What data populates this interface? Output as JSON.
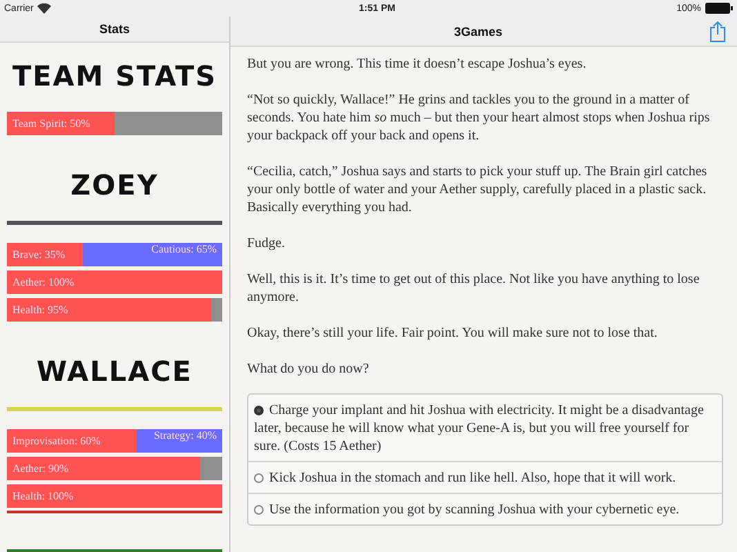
{
  "status_bar": {
    "carrier": "Carrier",
    "time": "1:51 PM",
    "battery": "100%"
  },
  "sidebar": {
    "title": "Stats",
    "team": {
      "heading": "TEAM STATS",
      "bars": [
        {
          "kind": "single",
          "label": "Team Spirit: 50%",
          "level": 0.5
        }
      ]
    },
    "characters": [
      {
        "name": "ZOEY",
        "color": "#555555",
        "bars": [
          {
            "kind": "split",
            "label": "Brave: 35%",
            "right_label": "Cautious: 65%",
            "level": 0.35
          },
          {
            "kind": "single",
            "label": "Aether: 100%",
            "level": 1
          },
          {
            "kind": "single",
            "label": "Health: 95%",
            "level": 0.95
          }
        ]
      },
      {
        "name": "WALLACE",
        "color": "#d4d45a",
        "bars": [
          {
            "kind": "split",
            "label": "Improvisation: 60%",
            "right_label": "Strategy: 40%",
            "level": 0.6
          },
          {
            "kind": "single",
            "label": "Aether: 90%",
            "level": 0.9
          },
          {
            "kind": "single",
            "label": "Health: 100%",
            "level": 1
          }
        ]
      }
    ],
    "extra_rules": [
      {
        "color": "#c0392b"
      },
      {
        "color": "#2e7d32"
      }
    ]
  },
  "story": {
    "title": "3Games",
    "paragraphs": [
      "But you are wrong. This time it doesn’t escape Joshua’s eyes.",
      "“Not so quickly, Wallace!” He grins and tackles you to the ground in a matter of seconds. You hate him *so* much – but then your heart almost stops when Joshua rips your backpack off your back and opens it.",
      "“Cecilia, catch,” Joshua says and starts to pick your stuff up. The Brain girl catches your only bottle of water and your Aether supply, carefully placed in a plastic sack. Basically everything you had.",
      "Fudge.",
      "Well, this is it. It’s time to get out of this place. Not like you have anything to lose anymore.",
      "Okay, there’s still your life. Fair point. You will make sure not to lose that.",
      "What do you do now?"
    ],
    "choices": [
      {
        "text": "Charge your implant and hit Joshua with electricity. It might be a disadvantage later, because he will know what your Gene-A is, but you will free yourself for sure. (Costs 15 Aether)",
        "selected": true
      },
      {
        "text": "Kick Joshua in the stomach and run like hell. Also, hope that it will work.",
        "selected": false
      },
      {
        "text": "Use the information you got by scanning Joshua with your cybernetic eye.",
        "selected": false
      }
    ]
  }
}
